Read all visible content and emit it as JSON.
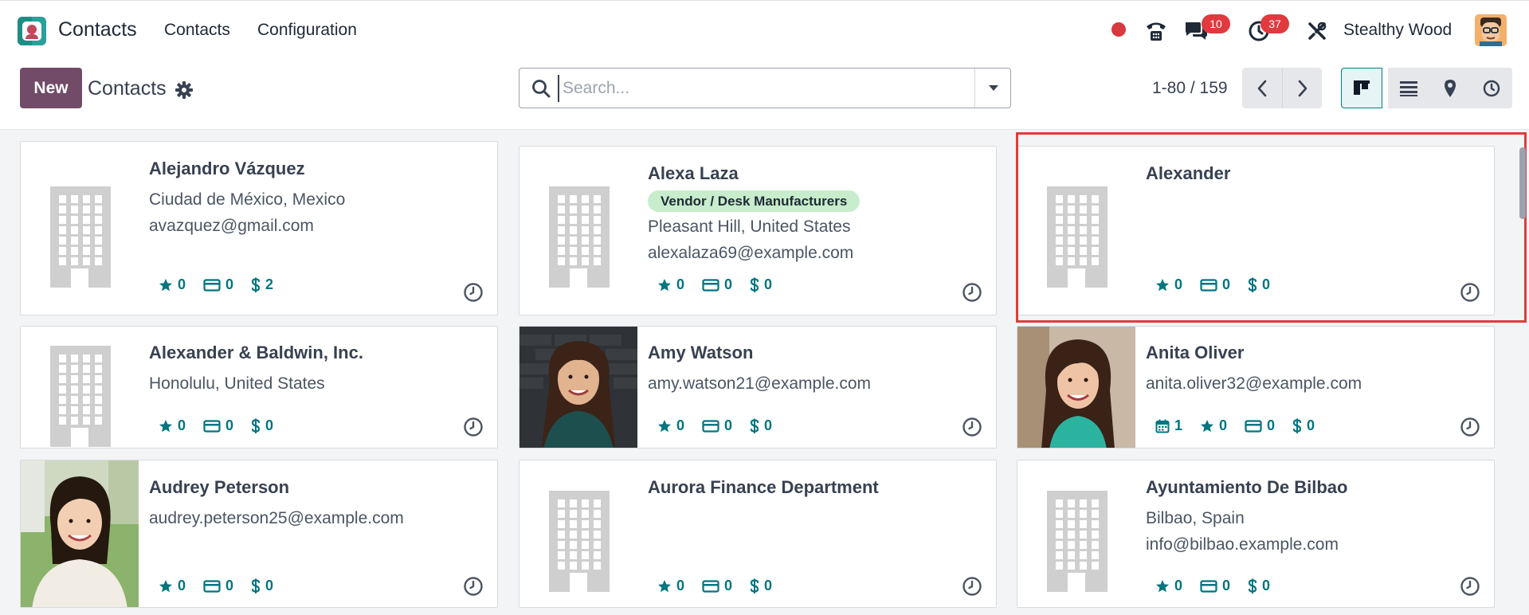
{
  "nav": {
    "app_title": "Contacts",
    "menus": [
      "Contacts",
      "Configuration"
    ],
    "messages_badge": "10",
    "activities_badge": "37",
    "user_name": "Stealthy Wood"
  },
  "control_panel": {
    "new_label": "New",
    "title": "Contacts",
    "search_placeholder": "Search...",
    "pager": "1-80 / 159"
  },
  "colors": {
    "brand": "#714b67",
    "accent": "#017e84",
    "badge": "#e03a3e",
    "tag": "#c7edcc",
    "highlight": "#e23b3b"
  },
  "cards": [
    {
      "name": "Alejandro Vázquez",
      "lines": [
        "Ciudad de México, Mexico",
        "avazquez@gmail.com"
      ],
      "image": "building",
      "stats": [
        {
          "icon": "star-icon",
          "value": "0"
        },
        {
          "icon": "card-icon",
          "value": "0"
        },
        {
          "icon": "dollar-icon",
          "value": "2"
        }
      ]
    },
    {
      "name": "Alexa Laza",
      "tag": "Vendor / Desk Manufacturers",
      "lines": [
        "Pleasant Hill, United States",
        "alexalaza69@example.com"
      ],
      "image": "building",
      "stats": [
        {
          "icon": "star-icon",
          "value": "0"
        },
        {
          "icon": "card-icon",
          "value": "0"
        },
        {
          "icon": "dollar-icon",
          "value": "0"
        }
      ]
    },
    {
      "name": "Alexander",
      "lines": [],
      "image": "building",
      "stats": [
        {
          "icon": "star-icon",
          "value": "0"
        },
        {
          "icon": "card-icon",
          "value": "0"
        },
        {
          "icon": "dollar-icon",
          "value": "0"
        }
      ]
    },
    {
      "name": "Alexander & Baldwin, Inc.",
      "lines": [
        "Honolulu, United States"
      ],
      "image": "building",
      "stats": [
        {
          "icon": "star-icon",
          "value": "0"
        },
        {
          "icon": "card-icon",
          "value": "0"
        },
        {
          "icon": "dollar-icon",
          "value": "0"
        }
      ]
    },
    {
      "name": "Amy Watson",
      "lines": [
        "amy.watson21@example.com"
      ],
      "image": "photo",
      "stats": [
        {
          "icon": "star-icon",
          "value": "0"
        },
        {
          "icon": "card-icon",
          "value": "0"
        },
        {
          "icon": "dollar-icon",
          "value": "0"
        }
      ]
    },
    {
      "name": "Anita Oliver",
      "lines": [
        "anita.oliver32@example.com"
      ],
      "image": "photo",
      "stats": [
        {
          "icon": "calendar-icon",
          "value": "1"
        },
        {
          "icon": "star-icon",
          "value": "0"
        },
        {
          "icon": "card-icon",
          "value": "0"
        },
        {
          "icon": "dollar-icon",
          "value": "0"
        }
      ]
    },
    {
      "name": "Audrey Peterson",
      "lines": [
        "audrey.peterson25@example.com"
      ],
      "image": "photo",
      "stats": [
        {
          "icon": "star-icon",
          "value": "0"
        },
        {
          "icon": "card-icon",
          "value": "0"
        },
        {
          "icon": "dollar-icon",
          "value": "0"
        }
      ]
    },
    {
      "name": "Aurora Finance Department",
      "lines": [],
      "image": "building",
      "stats": [
        {
          "icon": "star-icon",
          "value": "0"
        },
        {
          "icon": "card-icon",
          "value": "0"
        },
        {
          "icon": "dollar-icon",
          "value": "0"
        }
      ]
    },
    {
      "name": "Ayuntamiento De Bilbao",
      "lines": [
        "Bilbao, Spain",
        "info@bilbao.example.com"
      ],
      "image": "building",
      "stats": [
        {
          "icon": "star-icon",
          "value": "0"
        },
        {
          "icon": "card-icon",
          "value": "0"
        },
        {
          "icon": "dollar-icon",
          "value": "0"
        }
      ]
    }
  ]
}
